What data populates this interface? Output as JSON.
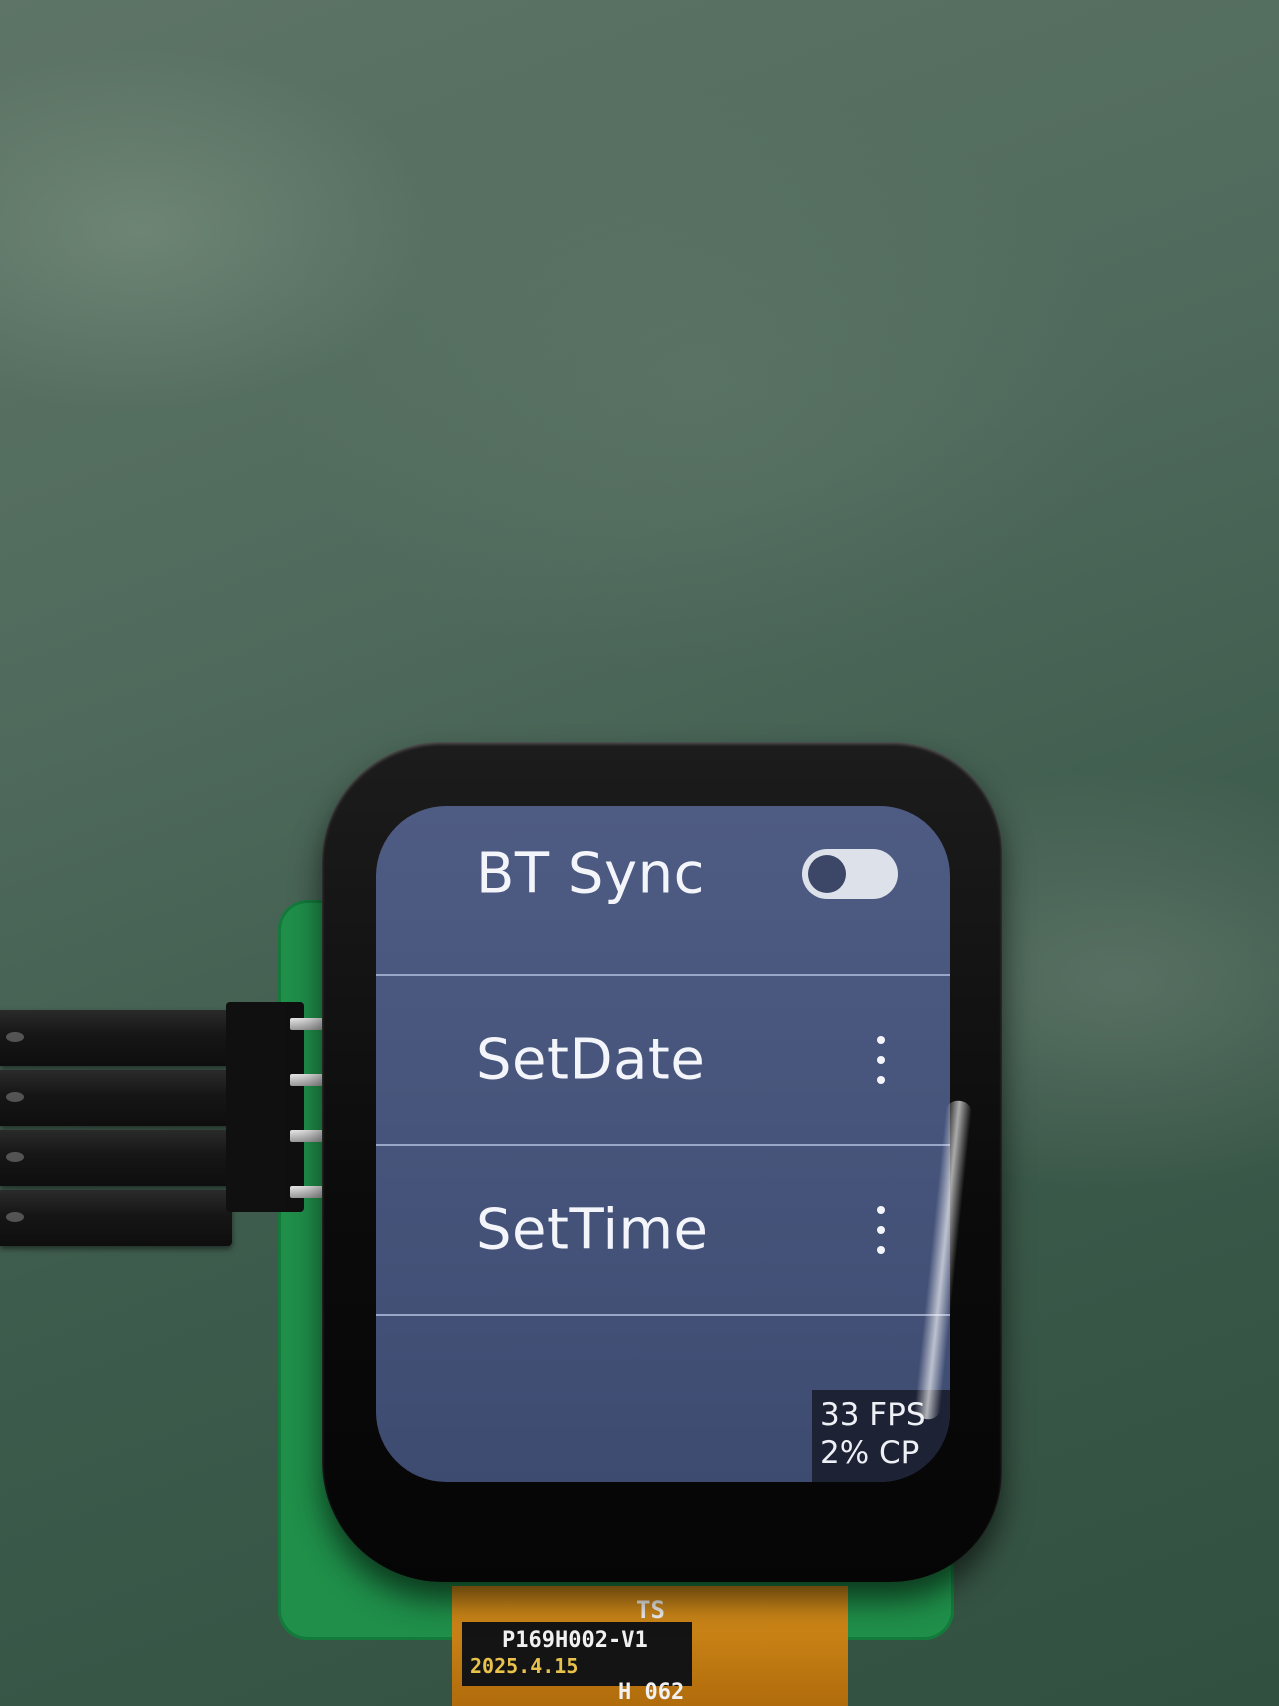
{
  "settings_list": {
    "items": [
      {
        "label": "BT Sync",
        "control": "toggle",
        "state": "off"
      },
      {
        "label": "SetDate",
        "control": "menu",
        "icon": "more-vertical-icon"
      },
      {
        "label": "SetTime",
        "control": "menu",
        "icon": "more-vertical-icon"
      }
    ]
  },
  "perf_overlay": {
    "fps": "33 FPS",
    "cpu": "2% CP"
  },
  "hardware": {
    "flex_cable": {
      "model": "P169H002-V1",
      "date": "2025.4.15",
      "code": "H 062",
      "mark": "TS"
    }
  },
  "colors": {
    "screen_background": "#47557c",
    "divider": "#9aa6c7",
    "text": "#f3f5fb",
    "toggle_track": "#dde1ea",
    "pcb": "#1f8f4a",
    "flex_cable": "#c07a12"
  }
}
